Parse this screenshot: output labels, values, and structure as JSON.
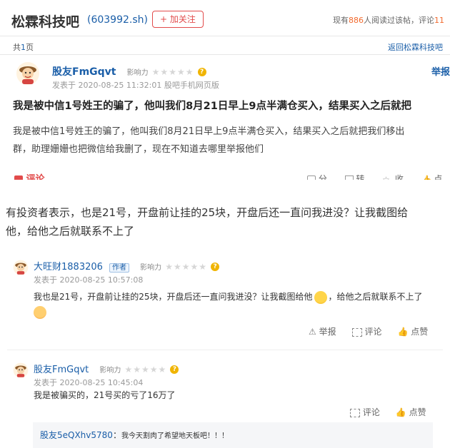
{
  "header": {
    "title": "松霖科技吧",
    "code": "(603992.sh)",
    "follow_label": "+ 加关注",
    "reading_prefix": "现有",
    "reading_count": "886",
    "reading_suffix": "人阅读过该帖，评论",
    "comment_count": "11"
  },
  "pager": {
    "total_prefix": "共",
    "total_pages": "1",
    "total_suffix": "页",
    "back_link": "返回松霖科技吧"
  },
  "post": {
    "author": "股友FmGqvt",
    "influence_label": "影响力",
    "stars": "★★★★★",
    "report_label": "举报",
    "meta": "发表于 2020-08-25 11:32:01 股吧手机网页版",
    "title": "我是被中信1号姓王的骗了，他叫我们8月21日早上9点半满仓买入，结果买入之后就把",
    "body_line1": "我是被中信1号姓王的骗了，他叫我们8月21日早上9点半满仓买入，结果买入之后就把我们移出",
    "body_line2": "群，助理姗姗也把微信给我删了，现在不知道去哪里举报他们",
    "comment_label": "评论",
    "share_label": "分享",
    "repost_label": "转发",
    "collect_label": "收藏",
    "like_label": "点赞"
  },
  "article": {
    "paragraph_line1": "有投资者表示，也是21号，开盘前让挂的25块，开盘后还一直问我进没？让我截图给",
    "paragraph_line2": "他，给他之后就联系不上了"
  },
  "reply1": {
    "author": "大旺财1883206",
    "author_badge": "作者",
    "influence_label": "影响力",
    "stars": "★★★★★",
    "meta": "发表于 2020-08-25 10:57:08",
    "text_part1": "我也是21号，开盘前让挂的25块，开盘后还一直问我进没？让我截图给他",
    "text_part2": "，给他之后就联系不上了",
    "report_label": "举报",
    "comment_label": "评论",
    "like_label": "点赞"
  },
  "reply2": {
    "author": "股友FmGqvt",
    "influence_label": "影响力",
    "stars": "★★★★★",
    "meta": "发表于 2020-08-25 10:45:04",
    "text": "我是被骗买的，21号买的亏了16万了",
    "comment_label": "评论",
    "like_label": "点赞",
    "sub_author": "股友5eQXhv5780",
    "sub_text": "我今天割肉了希望地天板吧！！！"
  },
  "colors": {
    "accent_red": "#e24b4b",
    "link_blue": "#1a5ea8",
    "count_orange": "#f26a2e"
  }
}
